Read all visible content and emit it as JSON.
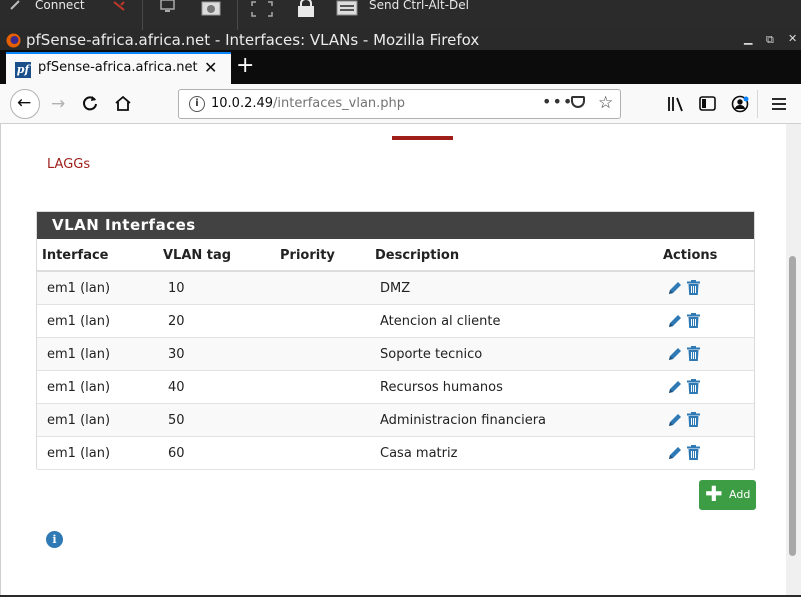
{
  "remote_toolbar": {
    "connect_label": "Connect",
    "send_cad_label": "Send Ctrl-Alt-Del"
  },
  "window": {
    "title": "pfSense-africa.africa.net - Interfaces: VLANs - Mozilla Firefox"
  },
  "tab": {
    "label": "pfSense-africa.africa.net",
    "close": "✕",
    "favicon": "pf",
    "new_tab": "+"
  },
  "address_bar": {
    "host": "10.0.2.49",
    "path": "/interfaces_vlan.php",
    "menu": "•••"
  },
  "page": {
    "laggs_link": "LAGGs",
    "panel_title": "VLAN Interfaces",
    "columns": [
      "Interface",
      "VLAN tag",
      "Priority",
      "Description",
      "Actions"
    ],
    "rows": [
      {
        "interface": "em1 (lan)",
        "vlan_tag": "10",
        "priority": "",
        "description": "DMZ"
      },
      {
        "interface": "em1 (lan)",
        "vlan_tag": "20",
        "priority": "",
        "description": "Atencion al cliente"
      },
      {
        "interface": "em1 (lan)",
        "vlan_tag": "30",
        "priority": "",
        "description": "Soporte tecnico"
      },
      {
        "interface": "em1 (lan)",
        "vlan_tag": "40",
        "priority": "",
        "description": "Recursos humanos"
      },
      {
        "interface": "em1 (lan)",
        "vlan_tag": "50",
        "priority": "",
        "description": "Administracion financiera"
      },
      {
        "interface": "em1 (lan)",
        "vlan_tag": "60",
        "priority": "",
        "description": "Casa matriz"
      }
    ],
    "add_button": "Add"
  },
  "colors": {
    "panel_header": "#424242",
    "link_red": "#9e1e1a",
    "add_green": "#3c9d45",
    "action_blue": "#2f79b5",
    "row_alt": "#f9f9f9"
  },
  "icons": [
    "keyboard-icon",
    "disconnect-icon",
    "monitor-icon",
    "screenshot-icon",
    "fullscreen-icon",
    "lock-icon",
    "send-cad-icon",
    "firefox-icon",
    "back-icon",
    "forward-icon",
    "reload-icon",
    "home-icon",
    "info-icon",
    "pocket-icon",
    "bookmark-star-icon",
    "library-icon",
    "sidebar-icon",
    "account-icon",
    "hamburger-menu-icon",
    "edit-pencil-icon",
    "delete-trash-icon",
    "plus-icon"
  ]
}
